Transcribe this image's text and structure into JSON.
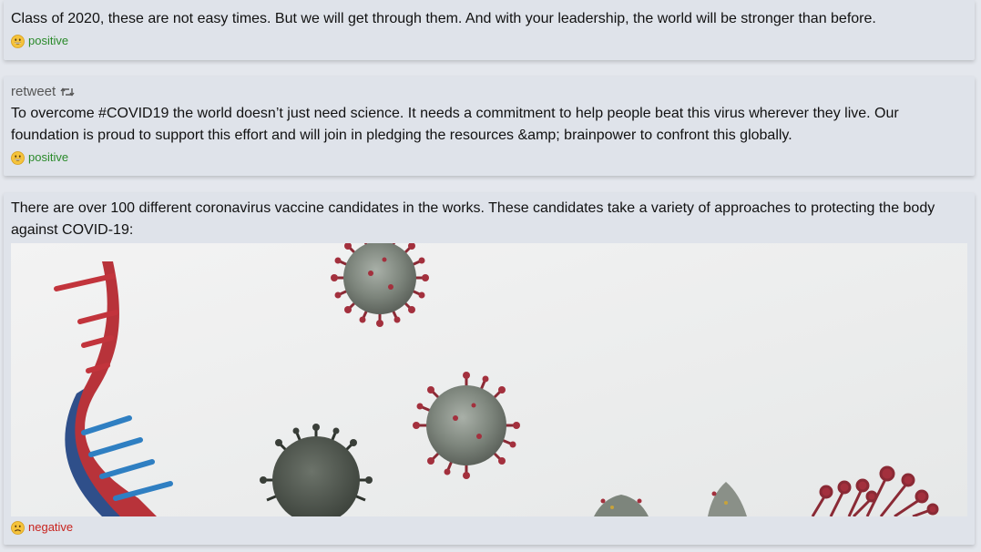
{
  "tweets": [
    {
      "text": "Class of 2020, these are not easy times. But we will get through them. And with your leadership, the world will be stronger than before.",
      "sentiment": "positive"
    },
    {
      "retweet_label": "retweet",
      "text": "To overcome #COVID19 the world doesn’t just need science. It needs a commitment to help people beat this virus wherever they live. Our foundation is proud to support this effort and will join in pledging the resources &amp; brainpower to confront this globally.",
      "sentiment": "positive"
    },
    {
      "text": "There are over 100 different coronavirus vaccine candidates in the works. These candidates take a variety of approaches to protecting the body against COVID-19:",
      "sentiment": "negative"
    }
  ],
  "colors": {
    "positive": "#2a8a2a",
    "negative": "#c8231e",
    "card_bg": "#dfe3ea"
  },
  "icons": {
    "retweet": "retweet-icon",
    "positive": "grinning-face-icon",
    "negative": "slightly-frowning-face-icon"
  }
}
